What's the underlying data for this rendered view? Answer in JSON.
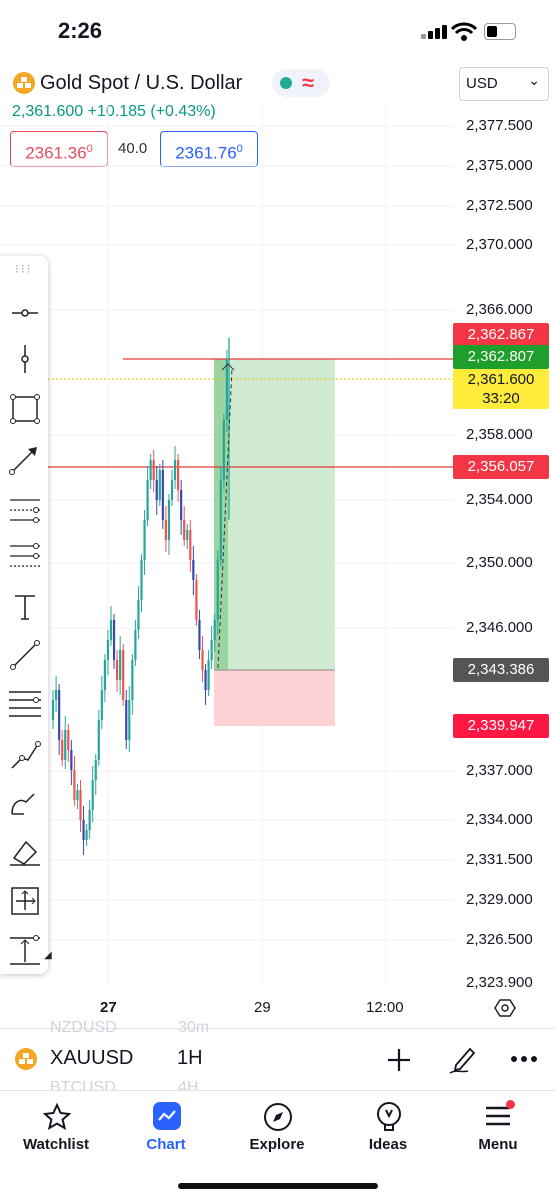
{
  "status_bar": {
    "time": "2:26"
  },
  "header": {
    "symbol_title": "Gold Spot / U.S. Dollar",
    "last_price": "2,361.600",
    "change": "+10.185",
    "change_pct": "(+0.43%)",
    "bid_main": "2361.36",
    "bid_sup": "0",
    "spread": "40.0",
    "ask_main": "2361.76",
    "ask_sup": "0",
    "currency": "USD"
  },
  "price_axis": {
    "ticks": [
      "2,377.500",
      "2,375.000",
      "2,372.500",
      "2,370.000",
      "2,366.000",
      "2,358.000",
      "2,354.000",
      "2,350.000",
      "2,346.000",
      "2,337.000",
      "2,334.000",
      "2,331.500",
      "2,329.000",
      "2,326.500",
      "2,323.900"
    ],
    "labels": {
      "stop_line": "2,362.867",
      "target": "2,362.807",
      "current": "2,361.600",
      "countdown": "33:20",
      "entry_line": "2,356.057",
      "position_entry": "2,343.386",
      "stop_loss": "2,339.947"
    }
  },
  "time_axis": {
    "labels": [
      "27",
      "29",
      "12:00"
    ]
  },
  "symbol_bar": {
    "symbol": "XAUUSD",
    "interval": "1H",
    "ghost_top_symbol": "NZDUSD",
    "ghost_top_interval": "30m",
    "ghost_bottom_symbol": "BTCUSD",
    "ghost_bottom_interval": "4H"
  },
  "nav": {
    "watchlist": "Watchlist",
    "chart": "Chart",
    "explore": "Explore",
    "ideas": "Ideas",
    "menu": "Menu"
  },
  "colors": {
    "up": "#26a69a",
    "down": "#ef5350",
    "green_zone": "#c8e6c9",
    "red_zone": "#ffcdd2",
    "accent": "#2962ff",
    "line_red": "#e53935"
  }
}
